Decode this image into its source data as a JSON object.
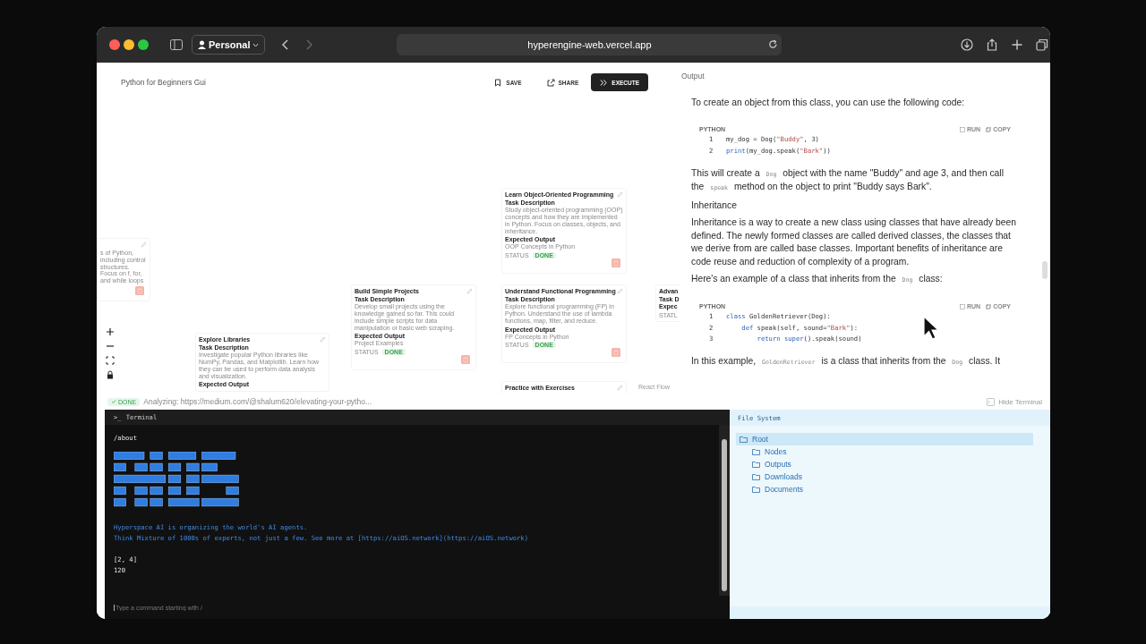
{
  "browser": {
    "profile": "Personal",
    "url": "hyperengine-web.vercel.app"
  },
  "header": {
    "title": "Python for Beginners Gui",
    "buttons": [
      {
        "kind": "save",
        "label": "SAVE"
      },
      {
        "kind": "share",
        "label": "SHARE"
      },
      {
        "kind": "execute",
        "label": "EXECUTE"
      }
    ]
  },
  "canvas": {
    "nodes": [
      {
        "title": "Learn Object-Oriented Programming",
        "sections": [
          {
            "label": "Task Description",
            "text": "Study object-oriented programming (OOP) concepts and how they are implemented in Python. Focus on classes, objects, and inheritance."
          },
          {
            "label": "Expected Output",
            "text": "OOP Concepts in Python"
          }
        ],
        "status_label": "STATUS",
        "status": "DONE",
        "deletable": true
      },
      {
        "title": "Build Simple Projects",
        "sections": [
          {
            "label": "Task Description",
            "text": "Develop small projects using the knowledge gained so far. This could include simple scripts for data manipulation or basic web scraping."
          },
          {
            "label": "Expected Output",
            "text": "Project Examples"
          }
        ],
        "status_label": "STATUS",
        "status": "DONE",
        "deletable": true
      },
      {
        "title": "Understand Functional Programming",
        "sections": [
          {
            "label": "Task Description",
            "text": "Explore functional programming (FP) in Python. Understand the use of lambda functions, map, filter, and reduce."
          },
          {
            "label": "Expected Output",
            "text": "FP Concepts in Python"
          }
        ],
        "status_label": "STATUS",
        "status": "DONE",
        "deletable": true
      },
      {
        "title": "Explore Libraries",
        "sections": [
          {
            "label": "Task Description",
            "text": "Investigate popular Python libraries like NumPy, Pandas, and Matplotlib. Learn how they can be used to perform data analysis and visualization."
          },
          {
            "label": "Expected Output"
          }
        ],
        "deletable": false
      },
      {
        "title": "Practice with Exercises",
        "deletable": false
      },
      {
        "title": "Advan",
        "sections": [
          {
            "label": "Task D"
          },
          {
            "label": "Expec"
          }
        ],
        "status_label": "STATL",
        "deletable": false
      },
      {
        "sections": [
          {
            "text": "s of Python, including control structures. Focus on f, for, and while loops"
          }
        ],
        "deletable": true
      }
    ],
    "attribution": "React Flow"
  },
  "output": {
    "title": "Output",
    "blocks": [
      {
        "kind": "para",
        "parts": [
          {
            "kind": "text",
            "text": "To create an object from this class, you can use the following code:"
          }
        ]
      },
      {
        "kind": "code",
        "language": "PYTHON",
        "actions": [
          "RUN",
          "COPY"
        ],
        "lines": [
          {
            "number": "1",
            "tokens": [
              {
                "kind": "plain",
                "text": "my_dog = Dog("
              },
              {
                "kind": "str",
                "text": "\"Buddy\""
              },
              {
                "kind": "plain",
                "text": ", 3)"
              }
            ]
          },
          {
            "number": "2",
            "tokens": [
              {
                "kind": "fn",
                "text": "print"
              },
              {
                "kind": "plain",
                "text": "(my_dog.speak("
              },
              {
                "kind": "str",
                "text": "\"Bark\""
              },
              {
                "kind": "plain",
                "text": "))"
              }
            ]
          }
        ]
      },
      {
        "kind": "para",
        "parts": [
          {
            "kind": "text",
            "text": "This will create a "
          },
          {
            "kind": "code",
            "text": "Dog"
          },
          {
            "kind": "text",
            "text": " object with the name \"Buddy\" and age 3, and then call the "
          },
          {
            "kind": "code",
            "text": "speak"
          },
          {
            "kind": "text",
            "text": " method on the object to print \"Buddy says Bark\"."
          }
        ]
      },
      {
        "kind": "heading",
        "parts": [
          {
            "kind": "text",
            "text": "Inheritance"
          }
        ]
      },
      {
        "kind": "para",
        "parts": [
          {
            "kind": "text",
            "text": "Inheritance is a way to create a new class using classes that have already been defined. The newly formed classes are called derived classes, the classes that we derive from are called base classes. Important benefits of inheritance are code reuse and reduction of complexity of a program."
          }
        ]
      },
      {
        "kind": "para",
        "parts": [
          {
            "kind": "text",
            "text": "Here's an example of a class that inherits from the "
          },
          {
            "kind": "code",
            "text": "Dog"
          },
          {
            "kind": "text",
            "text": " class:"
          }
        ]
      },
      {
        "kind": "code",
        "language": "PYTHON",
        "actions": [
          "RUN",
          "COPY"
        ],
        "lines": [
          {
            "number": "1",
            "tokens": [
              {
                "kind": "kw",
                "text": "class"
              },
              {
                "kind": "plain",
                "text": " GoldenRetriever(Dog):"
              }
            ]
          },
          {
            "number": "2",
            "tokens": [
              {
                "kind": "kw",
                "text": "    def"
              },
              {
                "kind": "plain",
                "text": " speak(self, sound="
              },
              {
                "kind": "str",
                "text": "\"Bark\""
              },
              {
                "kind": "plain",
                "text": "):"
              }
            ]
          },
          {
            "number": "3",
            "tokens": [
              {
                "kind": "kw",
                "text": "        return"
              },
              {
                "kind": "fn",
                "text": " super"
              },
              {
                "kind": "plain",
                "text": "().speak(sound)"
              }
            ]
          }
        ]
      },
      {
        "kind": "para",
        "parts": [
          {
            "kind": "text",
            "text": "In this example, "
          },
          {
            "kind": "code",
            "text": "GoldenRetriever"
          },
          {
            "kind": "text",
            "text": " is a class that inherits from the "
          },
          {
            "kind": "code",
            "text": "Dog"
          },
          {
            "kind": "text",
            "text": " class. It"
          }
        ]
      }
    ]
  },
  "status_bar": {
    "badge": "DONE",
    "text": "Analyzing: https://medium.com/@shalum620/elevating-your-pytho...",
    "hide_terminal": "Hide Terminal"
  },
  "terminal": {
    "icon": ">_",
    "title": "Terminal",
    "lines": [
      {
        "kind": "command",
        "text": "/about"
      },
      {
        "kind": "logo"
      },
      {
        "kind": "info",
        "text": "Hyperspace AI is organizing the world's AI agents."
      },
      {
        "kind": "info",
        "text": "Think Mixture of 1000s of experts, not just a few. See more at [https://aiOS.network](https://aiOS.network)"
      },
      {
        "kind": "output",
        "text": "[2, 4]"
      },
      {
        "kind": "output",
        "text": "120"
      }
    ],
    "placeholder": "Type a command starting with /"
  },
  "file_system": {
    "title": "File System",
    "tree": [
      {
        "label": "Root",
        "selected": true,
        "children": [
          {
            "label": "Nodes",
            "selected": false
          },
          {
            "label": "Outputs",
            "selected": false
          },
          {
            "label": "Downloads",
            "selected": false
          },
          {
            "label": "Documents",
            "selected": false
          }
        ]
      }
    ]
  }
}
